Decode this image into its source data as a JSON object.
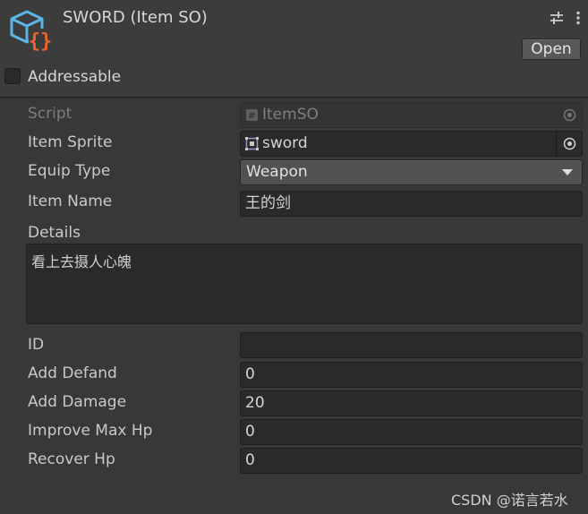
{
  "header": {
    "title": "SWORD (Item SO)",
    "open_label": "Open",
    "addressable_label": "Addressable",
    "addressable_checked": false
  },
  "fields": {
    "script": {
      "label": "Script",
      "value": "ItemSO"
    },
    "item_sprite": {
      "label": "Item Sprite",
      "value": "sword"
    },
    "equip_type": {
      "label": "Equip Type",
      "value": "Weapon"
    },
    "item_name": {
      "label": "Item Name",
      "value": "王的剑"
    },
    "details": {
      "label": "Details",
      "value": "看上去摄人心魄"
    },
    "id": {
      "label": "ID",
      "value": ""
    },
    "add_defand": {
      "label": "Add Defand",
      "value": "0"
    },
    "add_damage": {
      "label": "Add Damage",
      "value": "20"
    },
    "improve_max_hp": {
      "label": "Improve Max Hp",
      "value": "0"
    },
    "recover_hp": {
      "label": "Recover Hp",
      "value": "0"
    }
  },
  "watermark": "CSDN @诺言若水",
  "colors": {
    "background": "#383838",
    "field": "#2a2a2a",
    "icon_blue": "#5bb6e6",
    "icon_orange": "#e8662c"
  },
  "icons": {
    "asset": "scriptable-object-icon",
    "settings": "sliders-icon",
    "menu": "kebab-menu-icon",
    "script": "script-file-icon",
    "sprite": "sprite-icon",
    "picker": "object-picker-icon",
    "dropdown": "chevron-down-icon"
  }
}
